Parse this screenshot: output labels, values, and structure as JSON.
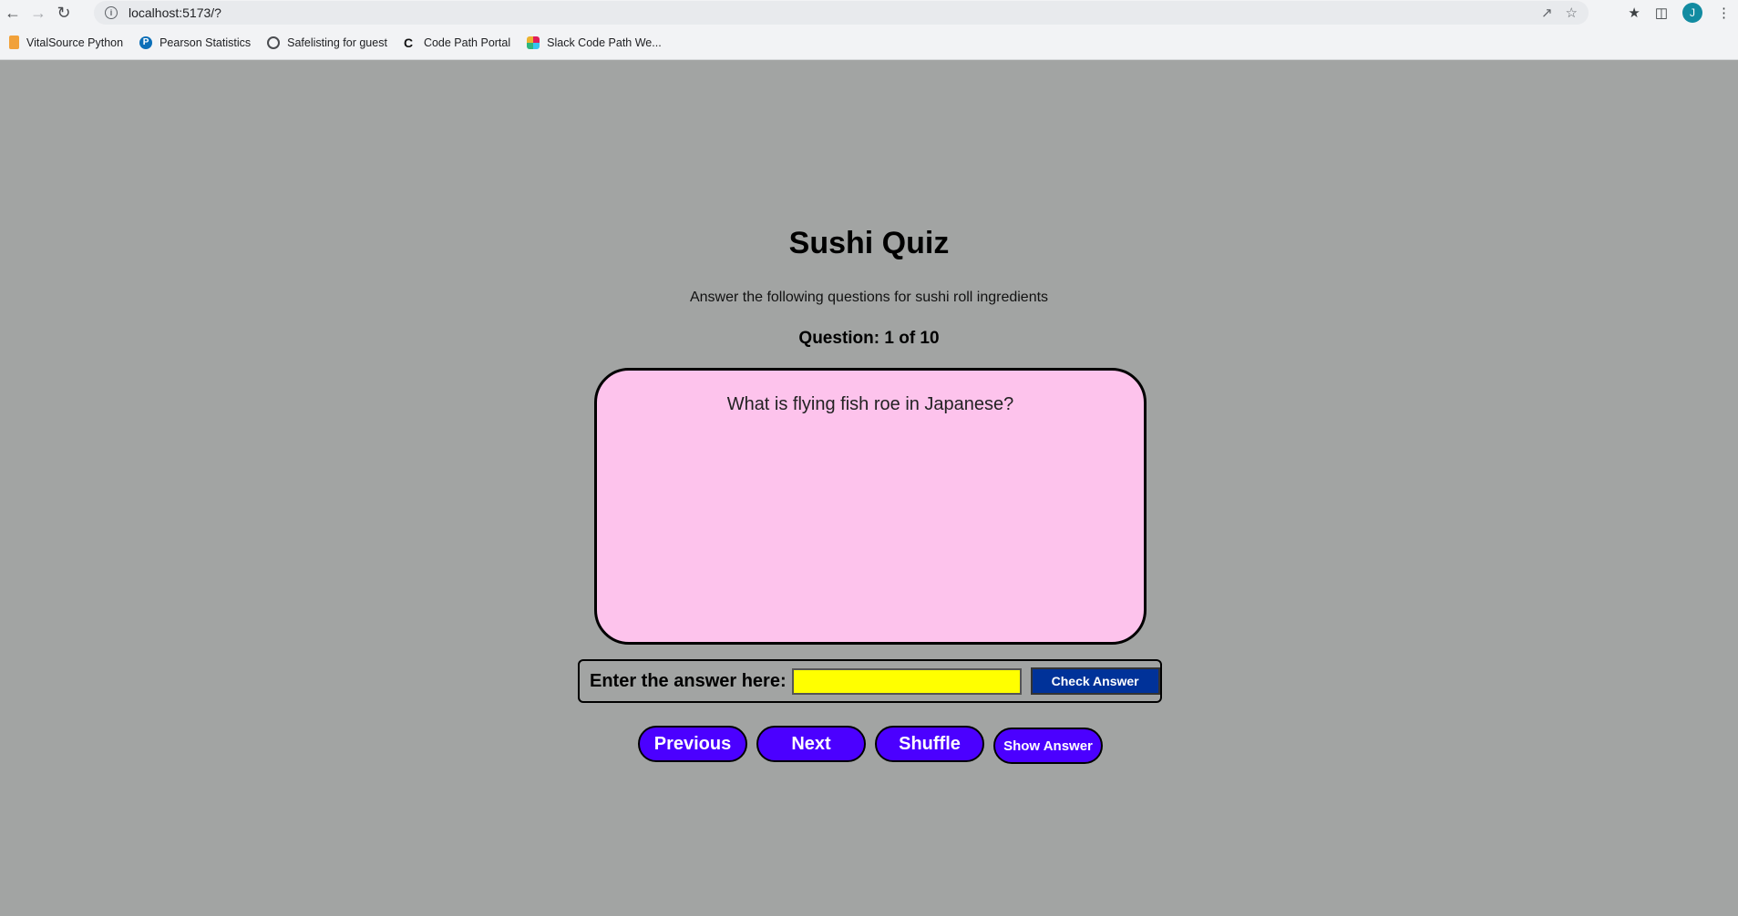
{
  "browser": {
    "url": "localhost:5173/?",
    "avatar_letter": "J",
    "bookmarks": [
      {
        "label": "VitalSource Python"
      },
      {
        "label": "Pearson Statistics"
      },
      {
        "label": "Safelisting for guest"
      },
      {
        "label": "Code Path Portal"
      },
      {
        "label": "Slack Code Path We..."
      }
    ]
  },
  "quiz": {
    "title": "Sushi Quiz",
    "subtitle": "Answer the following questions for sushi roll ingredients",
    "counter": "Question: 1 of 10",
    "question": "What is flying fish roe in Japanese?",
    "answer_label": "Enter the answer here:",
    "answer_value": "",
    "check_label": "Check Answer",
    "buttons": {
      "previous": "Previous",
      "next": "Next",
      "shuffle": "Shuffle",
      "show_answer": "Show Answer"
    }
  },
  "colors": {
    "page_bg": "#a2a4a3",
    "card_bg": "#fdc3ec",
    "input_bg": "#ffff00",
    "check_btn": "#003299",
    "pill_btn": "#4b00ff"
  }
}
